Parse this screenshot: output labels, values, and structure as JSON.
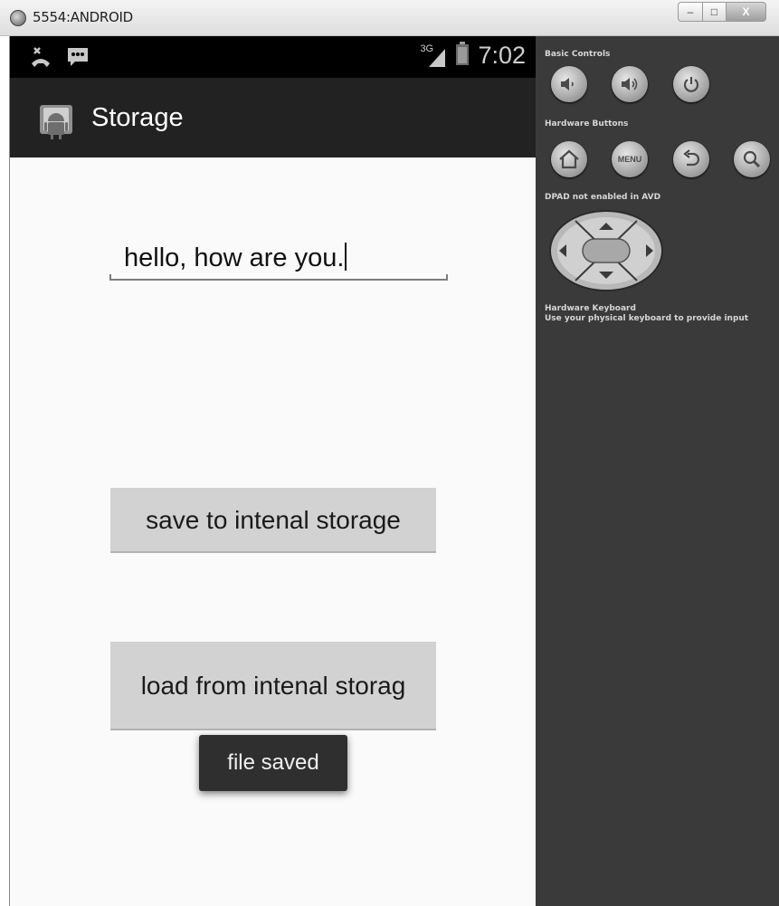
{
  "window": {
    "title": "5554:ANDROID",
    "minimize_label": "–",
    "maximize_label": "□",
    "close_label": "X"
  },
  "status_bar": {
    "network_label": "3G",
    "time": "7:02"
  },
  "action_bar": {
    "title": "Storage"
  },
  "main": {
    "edit_text_value": "hello, how are you.",
    "save_button_label": "save to intenal storage",
    "load_button_label": "load from intenal storag",
    "toast_text": "file saved"
  },
  "controls": {
    "basic_controls_label": "Basic Controls",
    "hardware_buttons_label": "Hardware Buttons",
    "menu_label": "MENU",
    "dpad_label": "DPAD not enabled in AVD",
    "keyboard_label": "Hardware Keyboard",
    "keyboard_hint": "Use your physical keyboard to provide input"
  }
}
